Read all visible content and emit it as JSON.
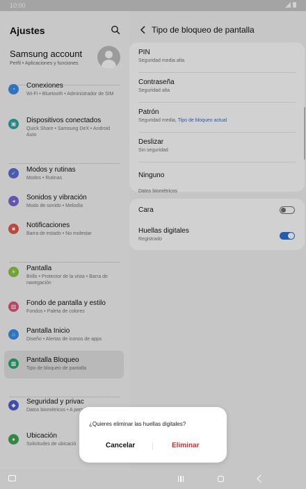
{
  "status": {
    "time": "10:00"
  },
  "left": {
    "title": "Ajustes",
    "account": {
      "name": "Samsung account",
      "sub": "Perfil • Aplicaciones y funciones"
    },
    "items": [
      {
        "label": "Conexiones",
        "desc": "Wi-Fi • Bluetooth • Administrador de SIM",
        "icon": "wifi-icon",
        "color": "#3b8ee8",
        "glyph": "◔"
      },
      {
        "label": "Dispositivos conectados",
        "desc": "Quick Share • Samsung DeX • Android Auto",
        "icon": "connected-devices-icon",
        "color": "#2aa8a0",
        "glyph": "▣"
      },
      {
        "label": "Modos y rutinas",
        "desc": "Modos • Rutinas",
        "icon": "modes-icon",
        "color": "#5b6ed8",
        "glyph": "✓"
      },
      {
        "label": "Sonidos y vibración",
        "desc": "Modo de sonido • Melodía",
        "icon": "sound-icon",
        "color": "#7b67d6",
        "glyph": "◂"
      },
      {
        "label": "Notificaciones",
        "desc": "Barra de estado • No molestar",
        "icon": "notifications-icon",
        "color": "#e6574b",
        "glyph": "■"
      },
      {
        "label": "Pantalla",
        "desc": "Brillo • Protector de la vista • Barra de navegación",
        "icon": "display-icon",
        "color": "#8cc63f",
        "glyph": "☀"
      },
      {
        "label": "Fondo de pantalla y estilo",
        "desc": "Fondos • Paleta de colores",
        "icon": "wallpaper-icon",
        "color": "#e0557a",
        "glyph": "▨"
      },
      {
        "label": "Pantalla Inicio",
        "desc": "Diseño • Alertas de iconos de apps",
        "icon": "home-screen-icon",
        "color": "#3b8ee8",
        "glyph": "⌂"
      },
      {
        "label": "Pantalla Bloqueo",
        "desc": "Tipo de bloqueo de pantalla",
        "icon": "lock-screen-icon",
        "color": "#2aa873",
        "glyph": "▩"
      },
      {
        "label": "Seguridad y privac",
        "desc": "Datos biométricos • A permisos",
        "icon": "security-icon",
        "color": "#4f5fd0",
        "glyph": "◆"
      },
      {
        "label": "Ubicación",
        "desc": "Solicitudes de ubicació",
        "icon": "location-icon",
        "color": "#3fa653",
        "glyph": "●"
      }
    ]
  },
  "right": {
    "title": "Tipo de bloqueo de pantalla",
    "options": [
      {
        "title": "PIN",
        "sub": "Seguridad media alta"
      },
      {
        "title": "Contraseña",
        "sub": "Seguridad alta"
      },
      {
        "title": "Patrón",
        "sub": "Seguridad media, ",
        "link": "Tipo de bloqueo actual"
      },
      {
        "title": "Deslizar",
        "sub": "Sin seguridad"
      },
      {
        "title": "Ninguno",
        "sub": ""
      }
    ],
    "biometrics_label": "Datos biométricos",
    "biometrics": [
      {
        "title": "Cara",
        "sub": "",
        "enabled": false
      },
      {
        "title": "Huellas digitales",
        "sub": "Registrado",
        "enabled": true
      }
    ]
  },
  "dialog": {
    "message": "¿Quieres eliminar las huellas digitales?",
    "cancel": "Cancelar",
    "delete": "Eliminar"
  }
}
